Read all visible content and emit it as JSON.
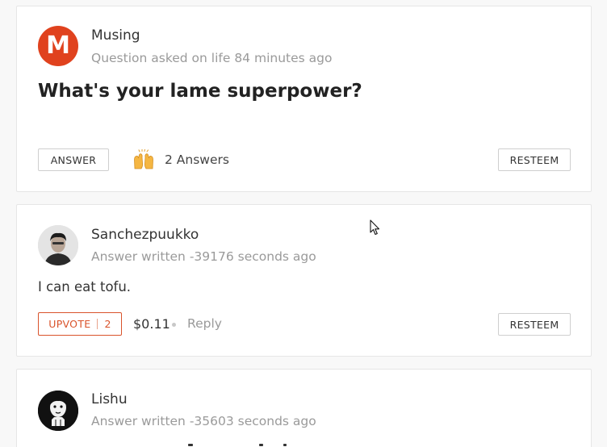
{
  "question": {
    "author": "Musing",
    "avatar_letter": "M",
    "meta": "Question asked on life 84 minutes ago",
    "title": "What's your lame superpower?",
    "answer_label": "ANSWER",
    "answers_count": "2 Answers",
    "resteem_label": "RESTEEM",
    "icon": "raising-hands-icon"
  },
  "answers": [
    {
      "author": "Sanchezpuukko",
      "meta": "Answer written -39176 seconds ago",
      "body": "I can eat tofu.",
      "upvote_label": "UPVOTE",
      "upvote_count": "2",
      "payout": "$0.11",
      "reply_label": "Reply",
      "resteem_label": "RESTEEM"
    },
    {
      "author": "Lishu",
      "meta": "Answer written -35603 seconds ago"
    }
  ],
  "colors": {
    "accent": "#d9532b",
    "avatar_m": "#e0421e",
    "muted_text": "#9a9a9a",
    "border": "#e6e6e6",
    "background": "#f8f8f8"
  }
}
